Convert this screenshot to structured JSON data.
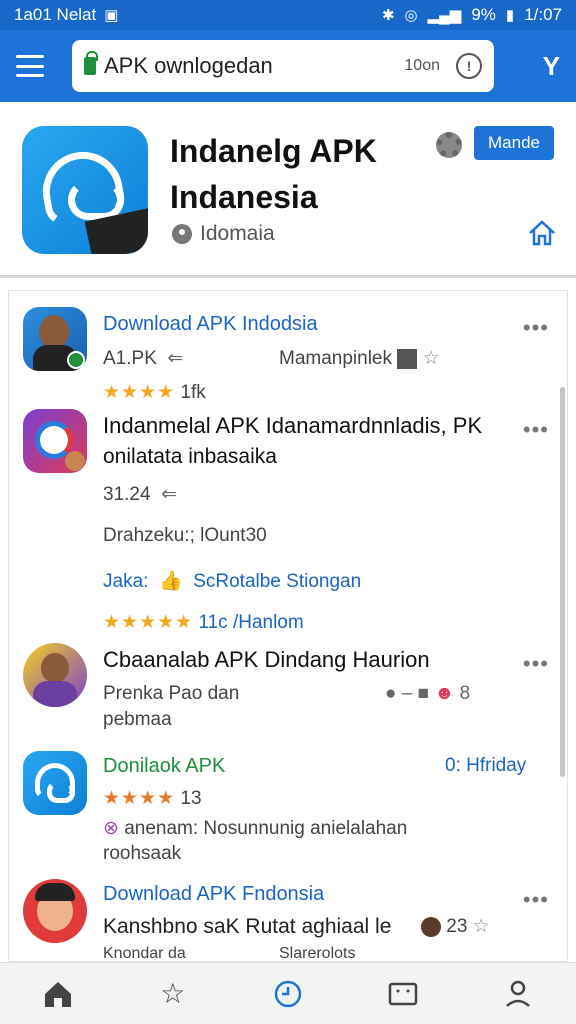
{
  "status_bar": {
    "left_text": "1a01 Nelat",
    "battery_text": "9%",
    "time": "1/:07"
  },
  "search": {
    "text": "APK ownlogedan",
    "size_text": "10on"
  },
  "header": {
    "title": "Indanelg APK Indanesia",
    "location": "Idomaia",
    "mode_label": "Mande"
  },
  "list": {
    "items": [
      {
        "title": "Download APK Indodsia",
        "meta_left": "A1.PK",
        "meta_right": "Mamanpinlek",
        "rating_text": "1fk"
      },
      {
        "title": "Indanmelal APK Idanamardnnladis, PK",
        "title_line2": "onilatata inbasaika",
        "version": "31.24",
        "detail": "Drahzeku:; lOunt30",
        "tag_label": "Jaka:",
        "tag_value": "ScRotalbe Stiongan",
        "rating_text": "11c /Hanlom"
      },
      {
        "title": "Cbaanalab APK Dindang Haurion",
        "line1": "Prenka Pao dan",
        "line2": "pebmaa"
      },
      {
        "title": "Donilaok APK",
        "right_text": "0: Hfriday",
        "rating_text": "13",
        "line1": "anenam: Nosunnunig anielalahan",
        "line2": "roohsaak"
      },
      {
        "title": "Download APK Fndonsia",
        "line1": "Kanshbno saK Rutat aghiaal le",
        "right_text": "23",
        "line2_left": "Knondar da",
        "line2_right": "Slarerolots"
      }
    ]
  },
  "colors": {
    "primary": "#1e73d8",
    "star": "#f2a81d",
    "green": "#1e8f3a"
  }
}
